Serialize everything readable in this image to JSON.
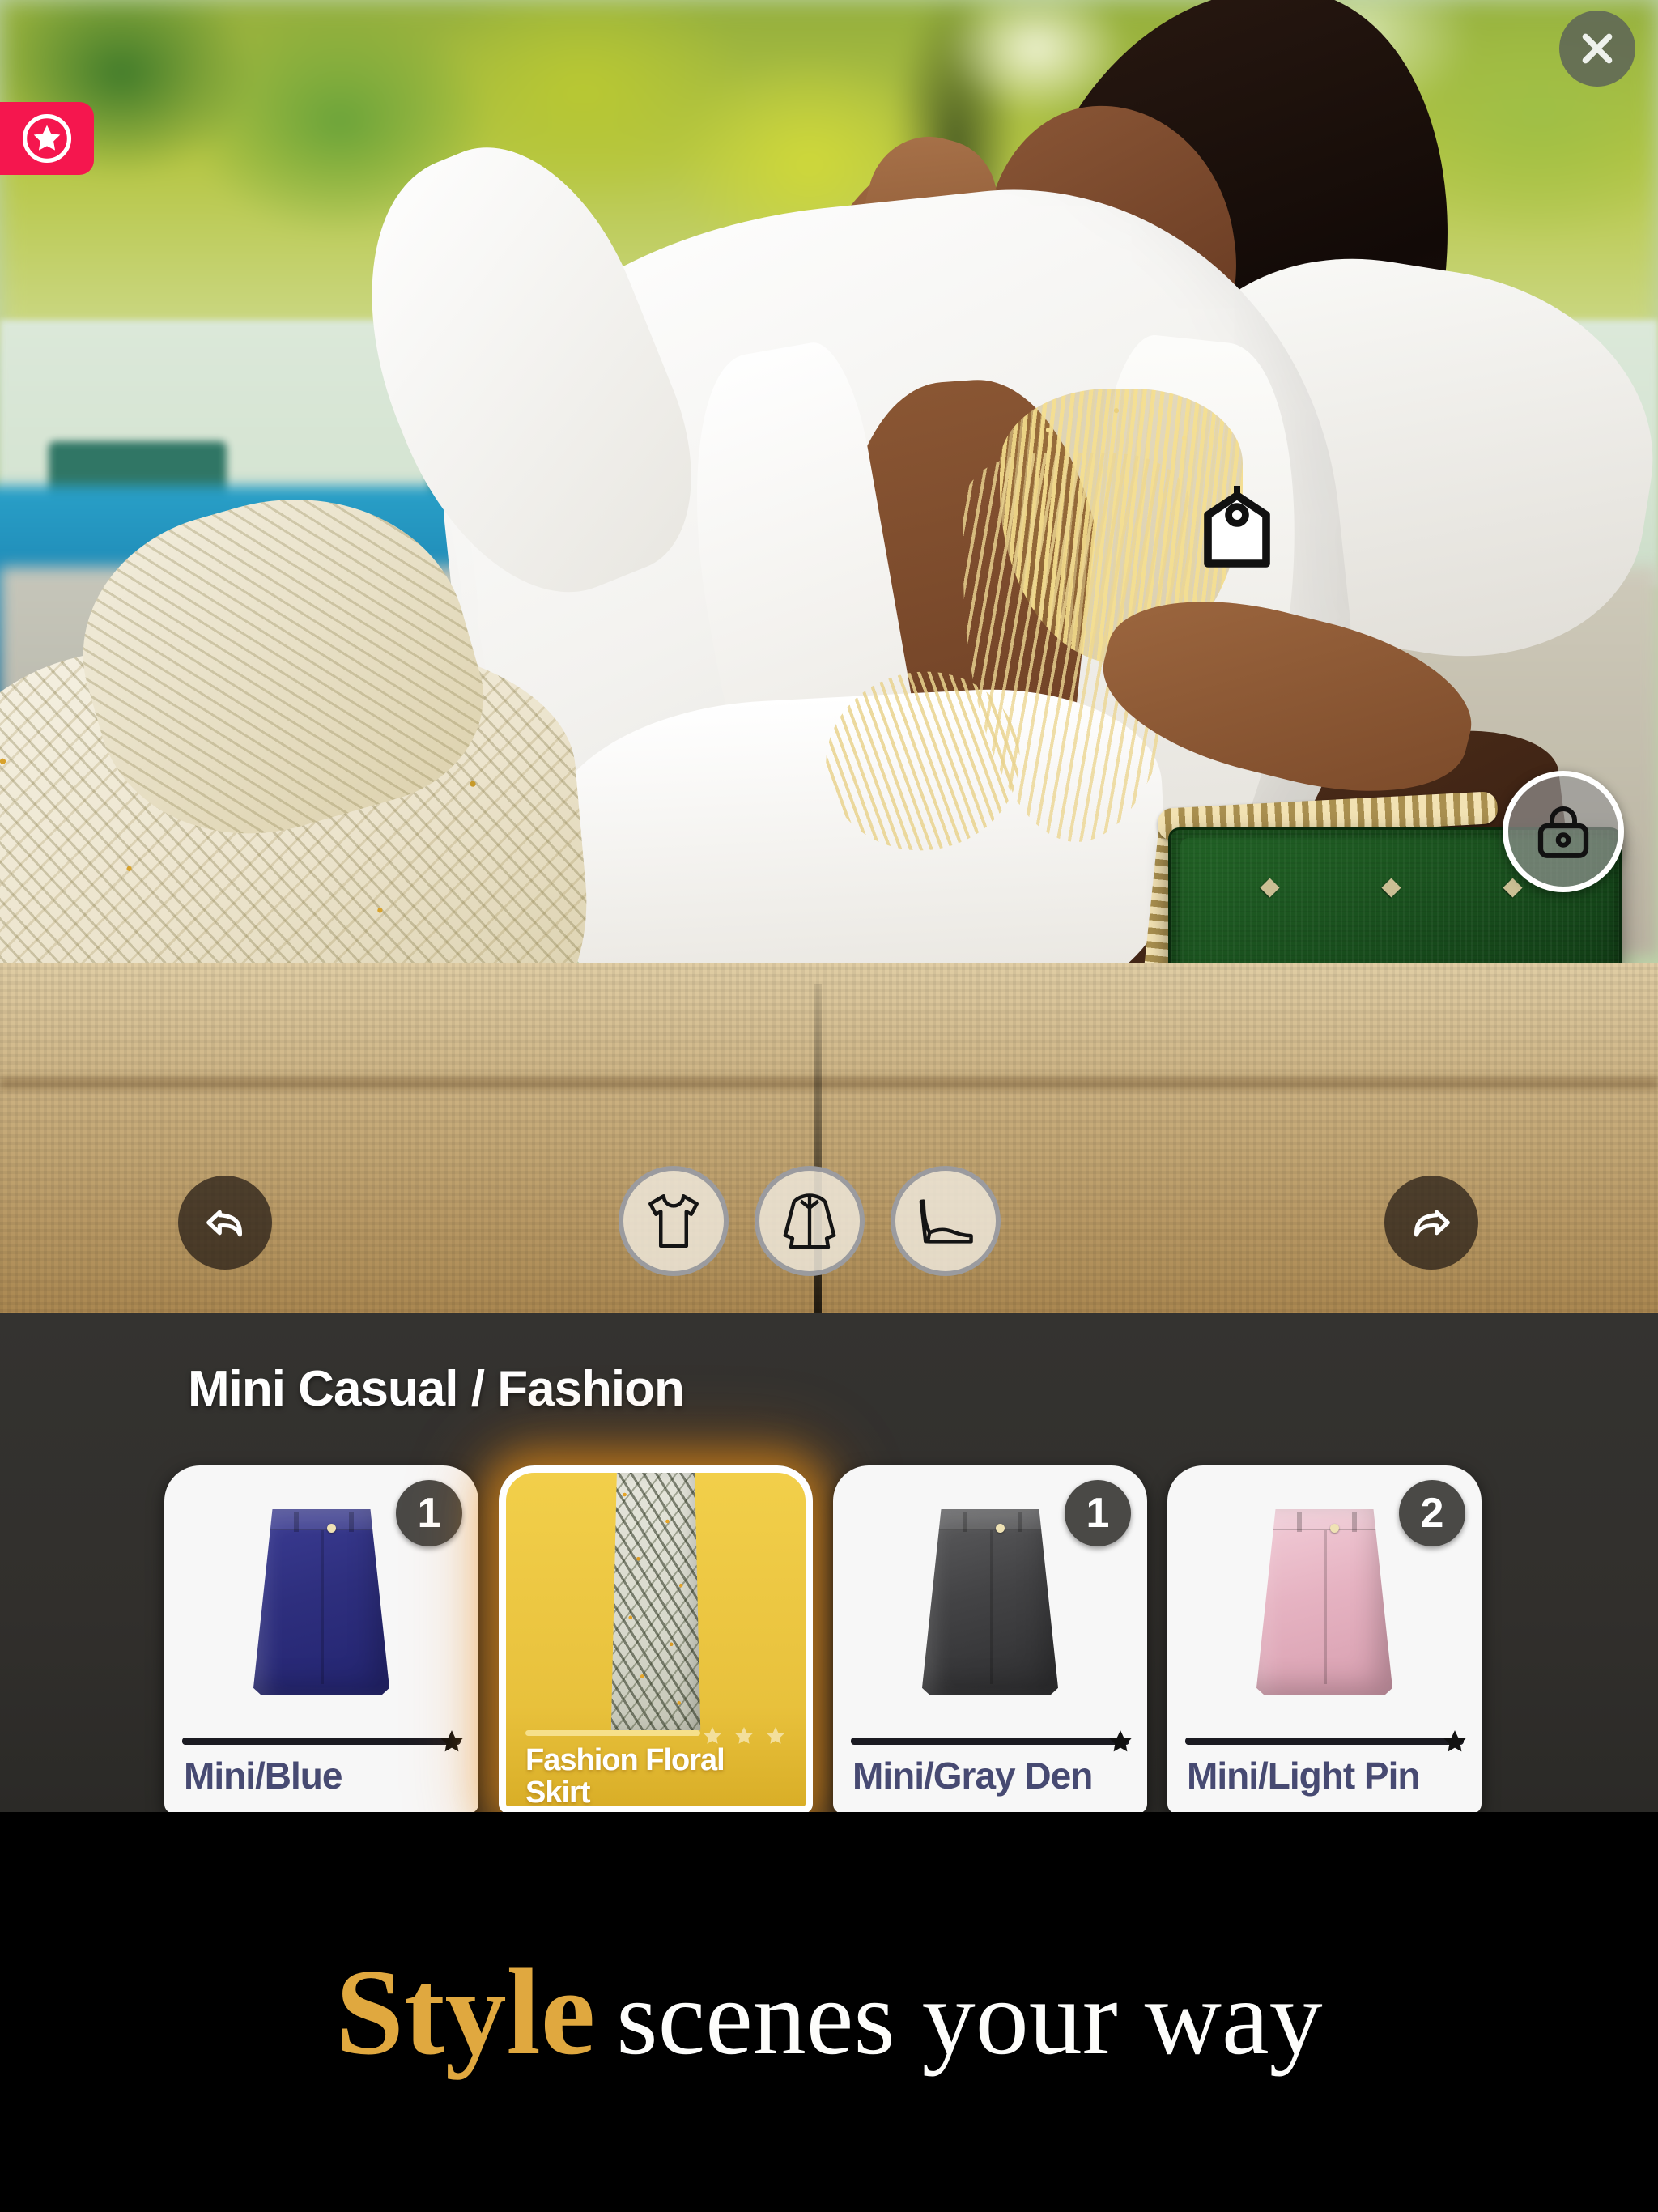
{
  "hero": {
    "close_icon": "close-icon",
    "favorite_badge_icon": "star-circle-icon",
    "bag_hotspot_icon": "handbag-icon",
    "tag_hotspot_icon": "price-tag-icon",
    "undo_icon": "undo-arrow-icon",
    "redo_icon": "redo-arrow-icon",
    "categories": [
      {
        "id": "tops",
        "icon": "tshirt-icon"
      },
      {
        "id": "outerwear",
        "icon": "coat-icon"
      },
      {
        "id": "shoes",
        "icon": "high-heel-icon"
      }
    ]
  },
  "panel": {
    "title": "Mini Casual / Fashion",
    "items": [
      {
        "label": "Mini/Blue",
        "qty": "1",
        "selected": false,
        "rarity_stars": 1,
        "color": "#2e2f7e",
        "thumb": "skirt-blue"
      },
      {
        "label": "Fashion Floral Skirt",
        "qty": "",
        "selected": true,
        "rarity_stars": 3,
        "color": "#d9d9cc",
        "thumb": "skirt-floral-long"
      },
      {
        "label": "Mini/Gray Den",
        "qty": "1",
        "selected": false,
        "rarity_stars": 1,
        "color": "#4a4a4c",
        "thumb": "skirt-gray"
      },
      {
        "label": "Mini/Light Pin",
        "qty": "2",
        "selected": false,
        "rarity_stars": 1,
        "color": "#e8b7c4",
        "thumb": "skirt-pink"
      }
    ]
  },
  "banner": {
    "accent_word": "Style",
    "rest_text": "scenes your way"
  },
  "colors": {
    "panel_bg": "#343330",
    "selected_card": "#e8c13c",
    "badge_pink": "#f5164e",
    "label_blue": "#474a72",
    "banner_gold": "#e0a83f"
  }
}
